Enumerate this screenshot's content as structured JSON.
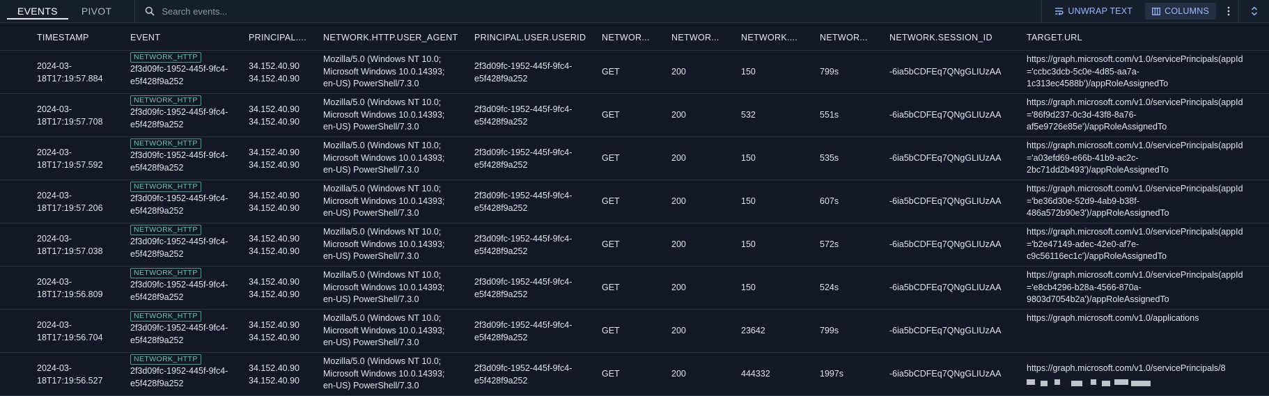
{
  "tabs": [
    {
      "label": "EVENTS",
      "active": true
    },
    {
      "label": "PIVOT",
      "active": false
    }
  ],
  "search": {
    "placeholder": "Search events..."
  },
  "actions": {
    "unwrap_label": "UNWRAP TEXT",
    "columns_label": "COLUMNS"
  },
  "columns": [
    "TIMESTAMP",
    "EVENT",
    "PRINCIPAL....",
    "NETWORK.HTTP.USER_AGENT",
    "PRINCIPAL.USER.USERID",
    "NETWOR...",
    "NETWOR...",
    "NETWORK....",
    "NETWOR...",
    "NETWORK.SESSION_ID",
    "TARGET.URL"
  ],
  "rows": [
    {
      "ts1": "2024-03-",
      "ts2": "18T17:19:57.884",
      "badge": "NETWORK_HTTP",
      "ev1": "2f3d09fc-1952-445f-9fc4-",
      "ev2": "e5f428f9a252",
      "ip1": "34.152.40.90",
      "ip2": "34.152.40.90",
      "ua1": "Mozilla/5.0 (Windows NT 10.0;",
      "ua2": "Microsoft Windows 10.0.14393;",
      "ua3": "en-US) PowerShell/7.3.0",
      "uid1": "2f3d09fc-1952-445f-9fc4-",
      "uid2": "e5f428f9a252",
      "method": "GET",
      "status": "200",
      "bytes": "150",
      "dur": "799s",
      "session": "-6ia5bCDFEq7QNgGLIUzAA",
      "url1": "https://graph.microsoft.com/v1.0/servicePrincipals(appId",
      "url2": "='ccbc3dcb-5c0e-4d85-aa7a-",
      "url3": "1c313ec4588b')/appRoleAssignedTo"
    },
    {
      "ts1": "2024-03-",
      "ts2": "18T17:19:57.708",
      "badge": "NETWORK_HTTP",
      "ev1": "2f3d09fc-1952-445f-9fc4-",
      "ev2": "e5f428f9a252",
      "ip1": "34.152.40.90",
      "ip2": "34.152.40.90",
      "ua1": "Mozilla/5.0 (Windows NT 10.0;",
      "ua2": "Microsoft Windows 10.0.14393;",
      "ua3": "en-US) PowerShell/7.3.0",
      "uid1": "2f3d09fc-1952-445f-9fc4-",
      "uid2": "e5f428f9a252",
      "method": "GET",
      "status": "200",
      "bytes": "532",
      "dur": "551s",
      "session": "-6ia5bCDFEq7QNgGLIUzAA",
      "url1": "https://graph.microsoft.com/v1.0/servicePrincipals(appId",
      "url2": "='86f9d237-0c3d-43f8-8a76-",
      "url3": "af5e9726e85e')/appRoleAssignedTo"
    },
    {
      "ts1": "2024-03-",
      "ts2": "18T17:19:57.592",
      "badge": "NETWORK_HTTP",
      "ev1": "2f3d09fc-1952-445f-9fc4-",
      "ev2": "e5f428f9a252",
      "ip1": "34.152.40.90",
      "ip2": "34.152.40.90",
      "ua1": "Mozilla/5.0 (Windows NT 10.0;",
      "ua2": "Microsoft Windows 10.0.14393;",
      "ua3": "en-US) PowerShell/7.3.0",
      "uid1": "2f3d09fc-1952-445f-9fc4-",
      "uid2": "e5f428f9a252",
      "method": "GET",
      "status": "200",
      "bytes": "150",
      "dur": "535s",
      "session": "-6ia5bCDFEq7QNgGLIUzAA",
      "url1": "https://graph.microsoft.com/v1.0/servicePrincipals(appId",
      "url2": "='a03efd69-e66b-41b9-ac2c-",
      "url3": "2bc71dd2b493')/appRoleAssignedTo"
    },
    {
      "ts1": "2024-03-",
      "ts2": "18T17:19:57.206",
      "badge": "NETWORK_HTTP",
      "ev1": "2f3d09fc-1952-445f-9fc4-",
      "ev2": "e5f428f9a252",
      "ip1": "34.152.40.90",
      "ip2": "34.152.40.90",
      "ua1": "Mozilla/5.0 (Windows NT 10.0;",
      "ua2": "Microsoft Windows 10.0.14393;",
      "ua3": "en-US) PowerShell/7.3.0",
      "uid1": "2f3d09fc-1952-445f-9fc4-",
      "uid2": "e5f428f9a252",
      "method": "GET",
      "status": "200",
      "bytes": "150",
      "dur": "607s",
      "session": "-6ia5bCDFEq7QNgGLIUzAA",
      "url1": "https://graph.microsoft.com/v1.0/servicePrincipals(appId",
      "url2": "='be36d30e-52d9-4ab9-b38f-",
      "url3": "486a572b90e3')/appRoleAssignedTo"
    },
    {
      "ts1": "2024-03-",
      "ts2": "18T17:19:57.038",
      "badge": "NETWORK_HTTP",
      "ev1": "2f3d09fc-1952-445f-9fc4-",
      "ev2": "e5f428f9a252",
      "ip1": "34.152.40.90",
      "ip2": "34.152.40.90",
      "ua1": "Mozilla/5.0 (Windows NT 10.0;",
      "ua2": "Microsoft Windows 10.0.14393;",
      "ua3": "en-US) PowerShell/7.3.0",
      "uid1": "2f3d09fc-1952-445f-9fc4-",
      "uid2": "e5f428f9a252",
      "method": "GET",
      "status": "200",
      "bytes": "150",
      "dur": "572s",
      "session": "-6ia5bCDFEq7QNgGLIUzAA",
      "url1": "https://graph.microsoft.com/v1.0/servicePrincipals(appId",
      "url2": "='b2e47149-adec-42e0-af7e-",
      "url3": "c9c56116ec1c')/appRoleAssignedTo"
    },
    {
      "ts1": "2024-03-",
      "ts2": "18T17:19:56.809",
      "badge": "NETWORK_HTTP",
      "ev1": "2f3d09fc-1952-445f-9fc4-",
      "ev2": "e5f428f9a252",
      "ip1": "34.152.40.90",
      "ip2": "34.152.40.90",
      "ua1": "Mozilla/5.0 (Windows NT 10.0;",
      "ua2": "Microsoft Windows 10.0.14393;",
      "ua3": "en-US) PowerShell/7.3.0",
      "uid1": "2f3d09fc-1952-445f-9fc4-",
      "uid2": "e5f428f9a252",
      "method": "GET",
      "status": "200",
      "bytes": "150",
      "dur": "524s",
      "session": "-6ia5bCDFEq7QNgGLIUzAA",
      "url1": "https://graph.microsoft.com/v1.0/servicePrincipals(appId",
      "url2": "='e8cb4296-b28a-4566-870a-",
      "url3": "9803d7054b2a')/appRoleAssignedTo"
    },
    {
      "ts1": "2024-03-",
      "ts2": "18T17:19:56.704",
      "badge": "NETWORK_HTTP",
      "ev1": "2f3d09fc-1952-445f-9fc4-",
      "ev2": "e5f428f9a252",
      "ip1": "34.152.40.90",
      "ip2": "34.152.40.90",
      "ua1": "Mozilla/5.0 (Windows NT 10.0;",
      "ua2": "Microsoft Windows 10.0.14393;",
      "ua3": "en-US) PowerShell/7.3.0",
      "uid1": "2f3d09fc-1952-445f-9fc4-",
      "uid2": "e5f428f9a252",
      "method": "GET",
      "status": "200",
      "bytes": "23642",
      "dur": "799s",
      "session": "-6ia5bCDFEq7QNgGLIUzAA",
      "url1": "",
      "url2": "https://graph.microsoft.com/v1.0/applications",
      "url3": ""
    },
    {
      "ts1": "2024-03-",
      "ts2": "18T17:19:56.527",
      "badge": "NETWORK_HTTP",
      "ev1": "2f3d09fc-1952-445f-9fc4-",
      "ev2": "e5f428f9a252",
      "ip1": "34.152.40.90",
      "ip2": "34.152.40.90",
      "ua1": "Mozilla/5.0 (Windows NT 10.0;",
      "ua2": "Microsoft Windows 10.0.14393;",
      "ua3": "en-US) PowerShell/7.3.0",
      "uid1": "2f3d09fc-1952-445f-9fc4-",
      "uid2": "e5f428f9a252",
      "method": "GET",
      "status": "200",
      "bytes": "444332",
      "dur": "1997s",
      "session": "-6ia5bCDFEq7QNgGLIUzAA",
      "url1": "https://graph.microsoft.com/v1.0/servicePrincipals/8",
      "url2": "",
      "url3": ""
    }
  ]
}
